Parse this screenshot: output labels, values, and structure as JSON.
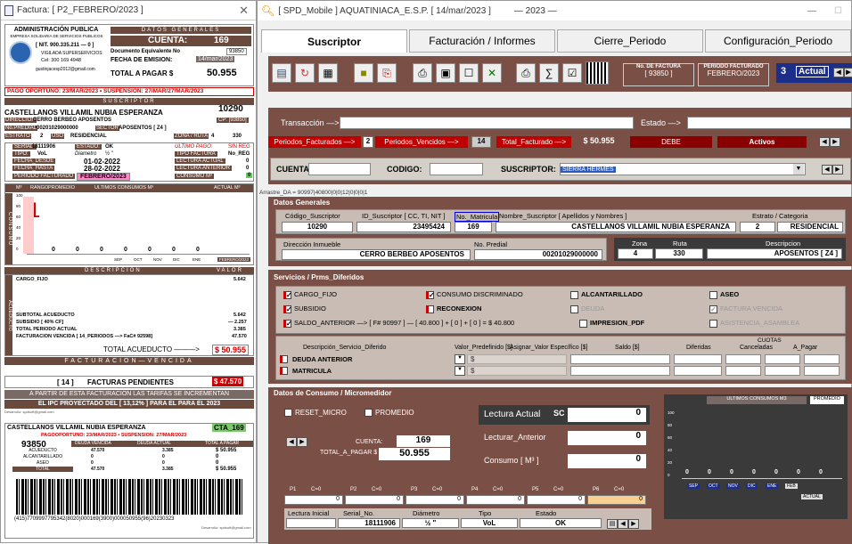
{
  "left_window": {
    "title": "Factura: [ P2_FEBRERO/2023 ]",
    "company": "ADMINISTRACIÓN PUBLICA",
    "company_sub": "EMPRESA SOLIDARIA DE SERVICIOS PUBLICOS",
    "nit": "[ NIT. 900.335.211 — 0 ]",
    "vigilada": "VIGILADA SUPERSERVICIOS",
    "cel": "Cel: 300 169 4948",
    "email": "gustinjacesp2012@gmail.com",
    "datos_generales": "DATOS GENERALES",
    "cuenta_label": "CUENTA:",
    "cuenta_val": "169",
    "doc_equiv": "Documento Equivalente No",
    "doc_equiv_val": "93850",
    "fecha_emision": "FECHA DE EMISION:",
    "fecha_emision_val": "14/mar/2023",
    "total_pagar_label": "TOTAL A PAGAR $",
    "total_pagar_val": "50.955",
    "pago_oportuno": "PAGO OPORTUNO: 23/MAR/2023 • SUSPENSION: 27/MAR/27/MAR/2023",
    "suscriptor_hdr": "SUSCRIPTOR",
    "suscriptor_name": "CASTELLANOS VILLAMIL NUBIA ESPERANZA",
    "suscriptor_code": "10290",
    "direccion_lbl": "DIRECCION",
    "direccion_val": "CERRO BERBEO APOSENTOS",
    "cp": "CP: [93850]",
    "npredial_lbl": "No.PREDIAL",
    "npredial_val": "00201029000000",
    "sector_lbl": "SECTOR",
    "sector_val": "APOSENTOS [ Z4 ]",
    "estrato_lbl": "ESTRATO",
    "estrato_val": "2",
    "uso_lbl": "USO",
    "uso_val": "RESIDENCIAL",
    "zona_lbl": "ZONA / RUTA",
    "zona_val": "4",
    "ruta_val": "330",
    "serial_lbl": "SERIAL:",
    "serial_val": "18111906",
    "estado_lbl": "ESTADO:",
    "estado_val": "OK",
    "ultimo_pago_lbl": "ULTIMO PAGO:",
    "ultimo_pago_val": "SIN REG",
    "tipo_lbl": "TIPO:",
    "tipo_val": "VoL",
    "diametro_lbl": "Diametro",
    "diametro_val": "½ \"",
    "tipo_factura_lbl": "TIPO FACTURA",
    "tipo_factura_val": "No_REG",
    "fecha_desde_lbl": "FECHA_DESDE",
    "fecha_desde_val": "01-02-2022",
    "lectura_actual_lbl": "LECTURA ACTUAL",
    "lectura_actual_val": "0",
    "fecha_hasta_lbl": "FECHA_HASTA",
    "fecha_hasta_val": "28-02-2022",
    "lectura_anterior_lbl": "LECTURA ANTERIOR",
    "lectura_anterior_val": "0",
    "periodo_fact_lbl": "PERIODO FACTURADO",
    "periodo_fact_val": "FEBRERO/2023",
    "consumo_m3_lbl": "CONSUMO M³",
    "consumo_m3_val": "0",
    "chart_hdr_m3": "M³",
    "chart_hdr_rango": "RANGO",
    "chart_hdr_prom": "PROMEDIO",
    "chart_hdr_ult": "ULTIMOS CONSUMOS M³",
    "chart_hdr_actual": "ACTUAL M³",
    "side_label": "CONSUMO",
    "chart_big": "1",
    "chart_yticks": [
      "100",
      "80",
      "60",
      "40",
      "20",
      "0"
    ],
    "chart_vals": [
      "0",
      "0",
      "0",
      "0",
      "0",
      "0",
      "0"
    ],
    "chart_months": [
      "SEP",
      "OCT",
      "NOV",
      "DIC",
      "ENE",
      "FEBRERO/2023"
    ],
    "desc_hdr": "DESCRIPCION",
    "valor_hdr": "VALOR",
    "cargo_fijo_lbl": "CARGO_FIJO",
    "cargo_fijo_val": "5.642",
    "acueducto_side": "ACUEDUCTO",
    "subtotal_lbl": "SUBTOTAL ACUEDUCTO",
    "subtotal_val": "5.642",
    "subsidio_lbl": "SUBSIDIO [ 40% CF]",
    "subsidio_val": "— 2.257",
    "total_periodo_lbl": "TOTAL PERIODO ACTUAL",
    "total_periodo_val": "3.385",
    "fact_vencida_lbl": "FACTURACION VENCIDA [ 14_PERIODOS —> FaC# 92598]",
    "fact_vencida_val": "47.570",
    "total_acueducto_lbl": "TOTAL ACUEDUCTO ———>",
    "total_acueducto_val": "$ 50.955",
    "facturacion_vencida": "FACTURACION—VENCIDA",
    "fact_pend_num": "[ 14 ]",
    "fact_pend_lbl": "FACTURAS PENDIENTES",
    "fact_pend_val": "$ 47.570",
    "ipc_line1": "A PARTIR DE ESTA FACTURACION LAS TARIFAS SE INCREMENTAN",
    "ipc_line2": "EL IPC PROYECTADO DEL [ 13,12% ] PARA EL PARA EL 2023",
    "developer": "Desarrollo: spdsoft@gmail.com",
    "stub_name": "CASTELLANOS VILLAMIL NUBIA ESPERANZA",
    "stub_cta": "CTA_169",
    "stub_pago": "PAGOOPORTUNO: 23/MAR/2023 • SUSPENSION: 27/MAR/2023",
    "stub_num": "93850",
    "stub_hdrs": [
      "DEUDA VENCIDA",
      "DEUDA ACTUAL",
      "TOTAL A PAGAR"
    ],
    "stub_rows": [
      {
        "label": "ACUEDUCTO",
        "a": "47.570",
        "b": "3.385",
        "c": "$ 50.955"
      },
      {
        "label": "ALCANTARILLADO",
        "a": "0",
        "b": "0",
        "c": "0"
      },
      {
        "label": "ASEO",
        "a": "0",
        "b": "0",
        "c": "0"
      },
      {
        "label": "TOTAL",
        "a": "47.570",
        "b": "3.385",
        "c": "$ 50.955"
      }
    ],
    "barcode_text": "(415)7709997795342(8020)000169(3900)000050955(96)20230323",
    "stub_dev": "Desarrollo: spdsoft@gmail.com"
  },
  "right_window": {
    "title": "[ SPD_Mobile ] AQUATINIACA_E.S.P.   [ 14/mar/2023 ]",
    "title_year": "— 2023 —",
    "tabs": [
      "Suscriptor",
      "Facturación / Informes",
      "Cierre_Periodo",
      "Configuración_Periodo"
    ],
    "no_factura_lbl": "No. DE FACTURA",
    "no_factura_val": "[ 93850 ]",
    "periodo_lbl": "PERIODO FACTURADO",
    "periodo_val": "FEBRERO/2023",
    "periodo_num": "3",
    "actual_lbl": "Actual",
    "transaccion_lbl": "Transacción —>",
    "estado_lbl": "Estado —>",
    "periodos_fact_lbl": "Periodos_Facturados —>",
    "periodos_fact_val": "2",
    "periodos_venc_lbl": "Periodos_Vencidos —>",
    "periodos_venc_val": "14",
    "total_fact_lbl": "Total_Facturado —>",
    "total_fact_val": "$ 50.955",
    "debe": "DEBE",
    "activos": "Activos",
    "cuenta_lbl": "CUENTA:",
    "codigo_lbl": "CODIGO:",
    "suscriptor_lbl": "SUSCRIPTOR:",
    "suscriptor_val": "SIERRA HERMES",
    "arrastre": "Arrastre_DA = 90997|40800|0|0|12|0|0|0|1",
    "datos_generales": "Datos Generales",
    "dg_headers": [
      "Código_Suscriptor",
      "ID_Suscriptor [ CC, TI, NIT ]",
      "No._Matricula",
      "Nombre_Suscriptor  [ Apellidos y Nombres ]",
      "Estrato / Categoria"
    ],
    "codigo_suscriptor": "10290",
    "id_suscriptor": "23495424",
    "no_matricula": "169",
    "nombre_suscriptor": "CASTELLANOS VILLAMIL NUBIA ESPERANZA",
    "estrato": "2",
    "categoria": "RESIDENCIAL",
    "direccion_lbl": "Dirección Inmueble",
    "direccion_val": "CERRO BERBEO APOSENTOS",
    "no_predial_lbl": "No. Predial",
    "no_predial_val": "00201029000000",
    "zona_lbl": "Zona",
    "zona_val": "4",
    "ruta_lbl": "Ruta",
    "ruta_val": "330",
    "descripcion_lbl": "Descripcion",
    "descripcion_val": "APOSENTOS [ Z4 ]",
    "servicios_hdr": "Servicios / Prms_Diferidos",
    "svc": {
      "cargo_fijo": "CARGO_FIJO",
      "consumo_discriminado": "CONSUMO DISCRIMINADO",
      "alcantarillado": "ALCANTARILLADO",
      "aseo": "ASEO",
      "subsidio": "SUBSIDIO",
      "reconexion": "RECONEXION",
      "deuda": "DEUDA",
      "factura_vencida": "FACTURA VENCIDA",
      "saldo_anterior": "SALDO_ANTERIOR —> [ F# 90997 ] — [ 40.800 ] + [ 0 ] + [ 0 ] = $ 40.800",
      "impresion_pdf": "IMPRESION_PDF",
      "asistencia": "ASISTENCIA_ASAMBLEA"
    },
    "cuotas_lbl": "CUOTAS",
    "dif_headers": [
      "Descripción_Servicio_Diferido",
      "Valor_Predefinido [$]",
      "Asignar_Valor Específico [$]",
      "Saldo [$]",
      "Diferidas",
      "Canceladas",
      "A_Pagar"
    ],
    "dif_rows": [
      "DEUDA ANTERIOR",
      "MATRICULA"
    ],
    "dif_sym": "$",
    "consumo_hdr": "Datos de Consumo / Micromedidor",
    "reset_micro": "RESET_MICRO",
    "promedio": "PROMEDIO",
    "cuenta_lbl2": "CUENTA:",
    "cuenta_val2": "169",
    "total_pagar_lbl": "TOTAL_A_PAGAR $",
    "total_pagar_val": "50.955",
    "lectura_actual_lbl": "Lectura Actual",
    "lectura_actual_sc": "SC",
    "lectura_actual_val": "0",
    "lectura_anterior_lbl": "Lecturar_Anterior",
    "lectura_anterior_val": "0",
    "consumo_lbl": "Consumo [ M³ ]",
    "consumo_val": "0",
    "periods": [
      {
        "p": "P1",
        "c": "C=0",
        "v": "0"
      },
      {
        "p": "P2",
        "c": "C=0",
        "v": "0"
      },
      {
        "p": "P3",
        "c": "C=0",
        "v": "0"
      },
      {
        "p": "P4",
        "c": "C=0",
        "v": "0"
      },
      {
        "p": "P5",
        "c": "C=0",
        "v": "0"
      },
      {
        "p": "P6",
        "c": "C=0",
        "v": "0"
      }
    ],
    "lectura_inicial_lbl": "Lectura Inicial",
    "serial_lbl": "Serial_No.",
    "serial_val": "18111906",
    "diametro_lbl": "Diámetro",
    "diametro_val": "½ \"",
    "tipo_lbl": "Tipo",
    "tipo_val": "VoL",
    "estado2_lbl": "Estado",
    "estado2_val": "OK",
    "mini_chart_hdr": "ULTIMOS CONSUMOS M3",
    "mini_chart_prom": "PROMEDIO",
    "mini_yticks": [
      "100",
      "80",
      "60",
      "40",
      "20",
      "0"
    ],
    "mini_vals": [
      "0",
      "0",
      "0",
      "0",
      "0",
      "0",
      "0"
    ],
    "mini_months": [
      "SEP",
      "OCT",
      "NOV",
      "DIC",
      "ENE",
      "FEB"
    ],
    "mini_actual": "ACTUAL"
  }
}
